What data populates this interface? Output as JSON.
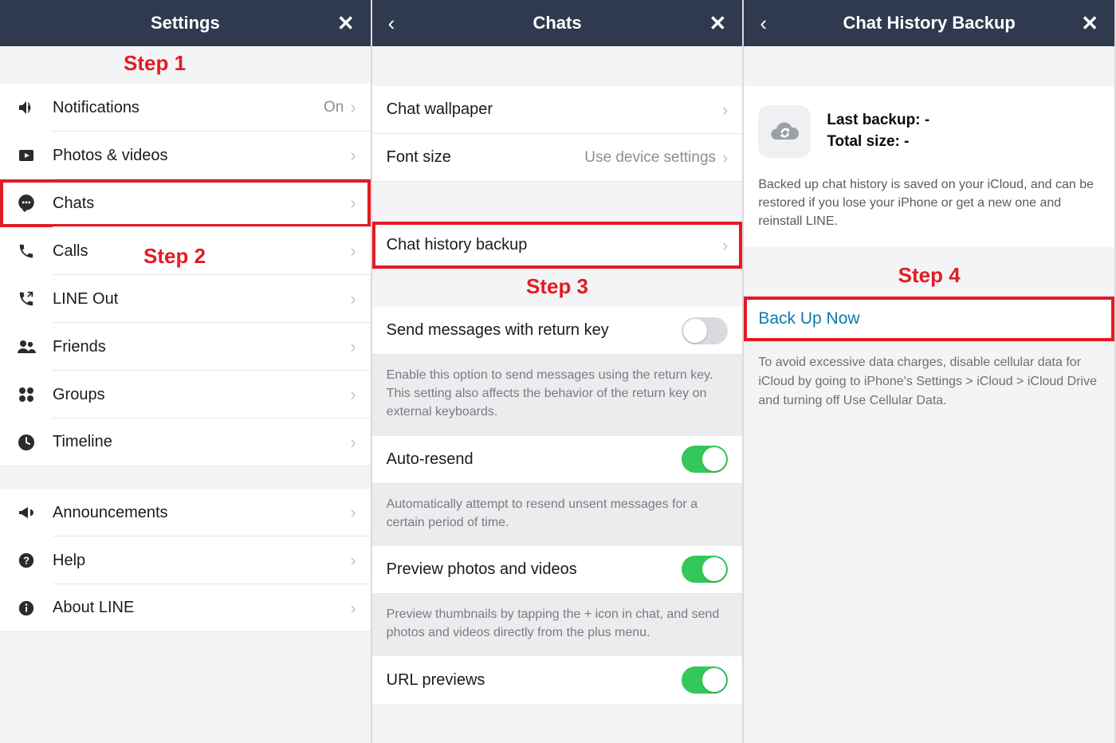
{
  "steps": {
    "s1": "Step 1",
    "s2": "Step 2",
    "s3": "Step 3",
    "s4": "Step 4"
  },
  "colors": {
    "accent_red": "#e31b23",
    "toggle_on": "#34c759",
    "navbar_bg": "#2f3a4f",
    "link_blue": "#0f7aad"
  },
  "screen1": {
    "title": "Settings",
    "items": [
      {
        "label": "Notifications",
        "value": "On",
        "icon": "volume"
      },
      {
        "label": "Photos & videos",
        "icon": "media"
      },
      {
        "label": "Chats",
        "icon": "chat",
        "highlight": true
      },
      {
        "label": "Calls",
        "icon": "phone"
      },
      {
        "label": "LINE Out",
        "icon": "lineout"
      },
      {
        "label": "Friends",
        "icon": "friends"
      },
      {
        "label": "Groups",
        "icon": "groups"
      },
      {
        "label": "Timeline",
        "icon": "timeline"
      }
    ],
    "items2": [
      {
        "label": "Announcements",
        "icon": "megaphone"
      },
      {
        "label": "Help",
        "icon": "help"
      },
      {
        "label": "About LINE",
        "icon": "info"
      }
    ]
  },
  "screen2": {
    "title": "Chats",
    "group1": [
      {
        "label": "Chat wallpaper"
      },
      {
        "label": "Font size",
        "value": "Use device settings"
      }
    ],
    "backup_row": {
      "label": "Chat history backup"
    },
    "return_key": {
      "label": "Send messages with return key",
      "on": false,
      "note": "Enable this option to send messages using the return key. This setting also affects the behavior of the return key on external keyboards."
    },
    "autoresend": {
      "label": "Auto-resend",
      "on": true,
      "note": "Automatically attempt to resend unsent messages for a certain period of time."
    },
    "preview": {
      "label": "Preview photos and videos",
      "on": true,
      "note": "Preview thumbnails by tapping the + icon in chat, and send photos and videos directly from the plus menu."
    },
    "url_previews": {
      "label": "URL previews",
      "on": true
    }
  },
  "screen3": {
    "title": "Chat History Backup",
    "last_backup_label": "Last backup: -",
    "total_size_label": "Total size: -",
    "description": "Backed up chat history is saved on your iCloud, and can be restored if you lose your iPhone or get a new one and reinstall LINE.",
    "backup_now": "Back Up Now",
    "footnote": "To avoid excessive data charges, disable cellular data for iCloud by going to\niPhone's Settings > iCloud > iCloud Drive and turning off Use Cellular Data."
  }
}
